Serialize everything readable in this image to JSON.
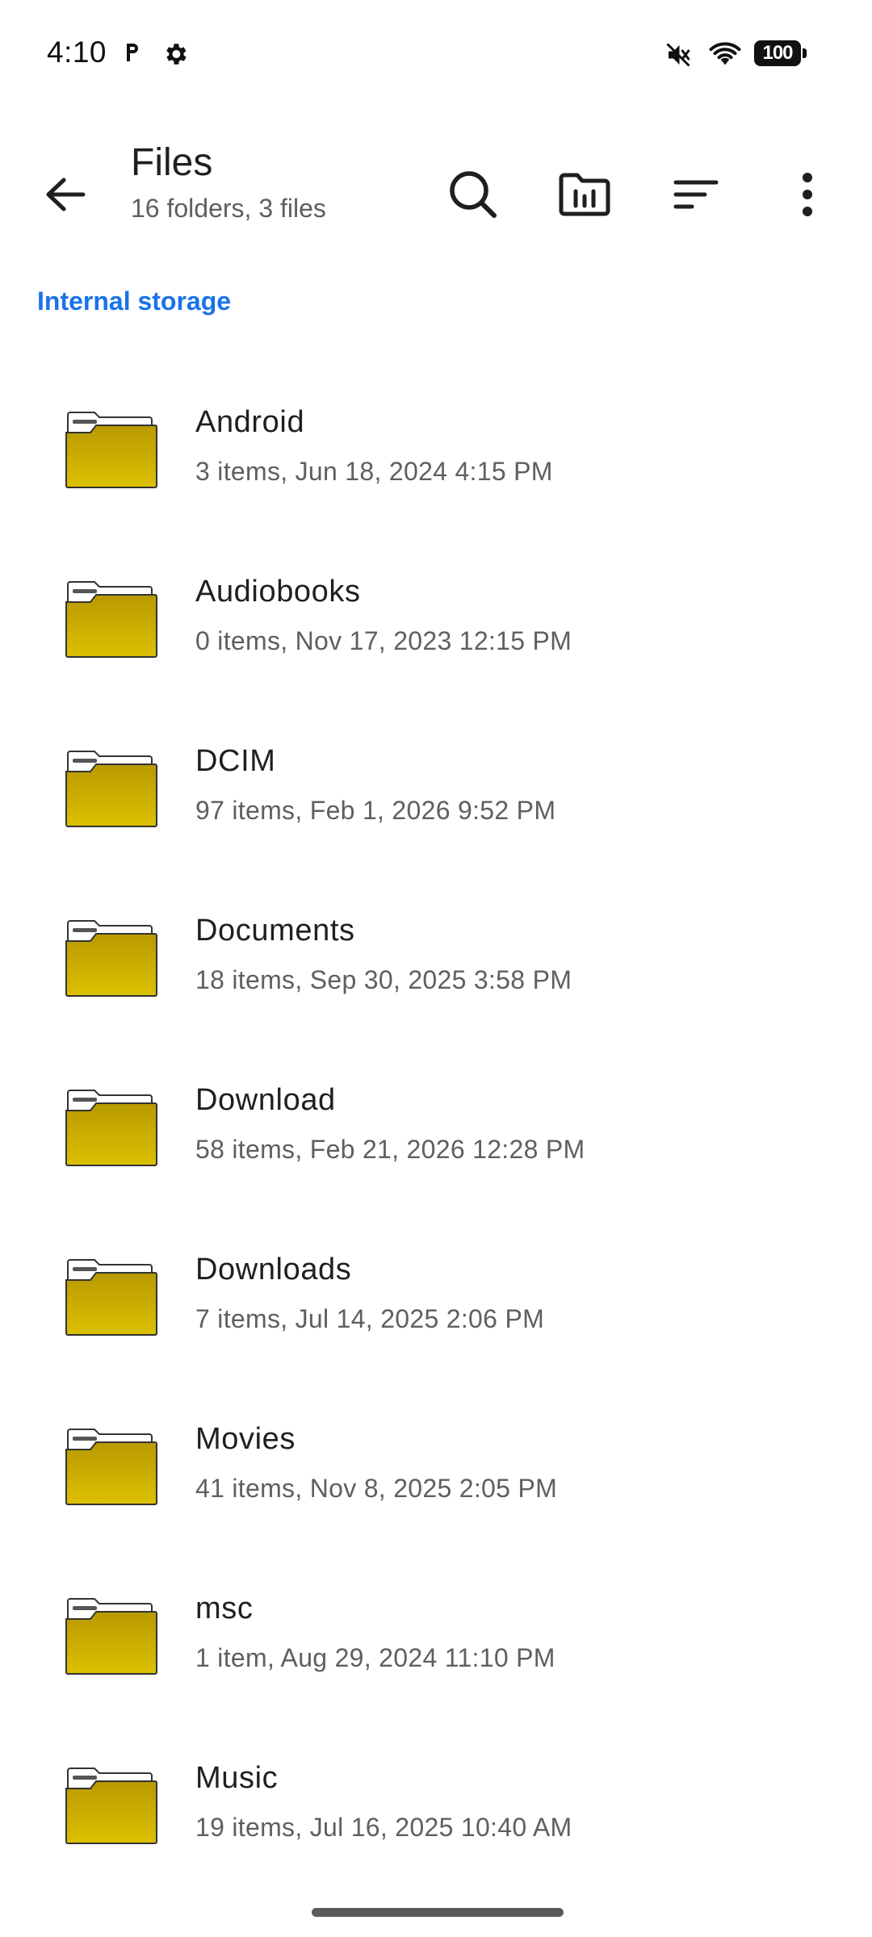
{
  "status_bar": {
    "time": "4:10",
    "battery": "100",
    "icons": [
      "parking-icon",
      "settings-gear-icon",
      "vibrate-mute-icon",
      "wifi-icon",
      "battery-icon"
    ]
  },
  "app_bar": {
    "title": "Files",
    "subtitle": "16 folders, 3 files",
    "actions": [
      "search-icon",
      "storage-icon",
      "sort-icon",
      "more-vert-icon"
    ]
  },
  "breadcrumb": "Internal storage",
  "colors": {
    "accent": "#1a73e8",
    "folder_fill": "#d4b500",
    "folder_fill_dark": "#b89a00"
  },
  "items": [
    {
      "name": "Android",
      "meta": "3 items, Jun 18, 2024 4:15 PM"
    },
    {
      "name": "Audiobooks",
      "meta": "0 items, Nov 17, 2023 12:15 PM"
    },
    {
      "name": "DCIM",
      "meta": "97 items, Feb 1, 2026 9:52 PM"
    },
    {
      "name": "Documents",
      "meta": "18 items, Sep 30, 2025 3:58 PM"
    },
    {
      "name": "Download",
      "meta": "58 items, Feb 21, 2026 12:28 PM"
    },
    {
      "name": "Downloads",
      "meta": "7 items, Jul 14, 2025 2:06 PM"
    },
    {
      "name": "Movies",
      "meta": "41 items, Nov 8, 2025 2:05 PM"
    },
    {
      "name": "msc",
      "meta": "1 item, Aug 29, 2024 11:10 PM"
    },
    {
      "name": "Music",
      "meta": "19 items, Jul 16, 2025 10:40 AM"
    }
  ]
}
